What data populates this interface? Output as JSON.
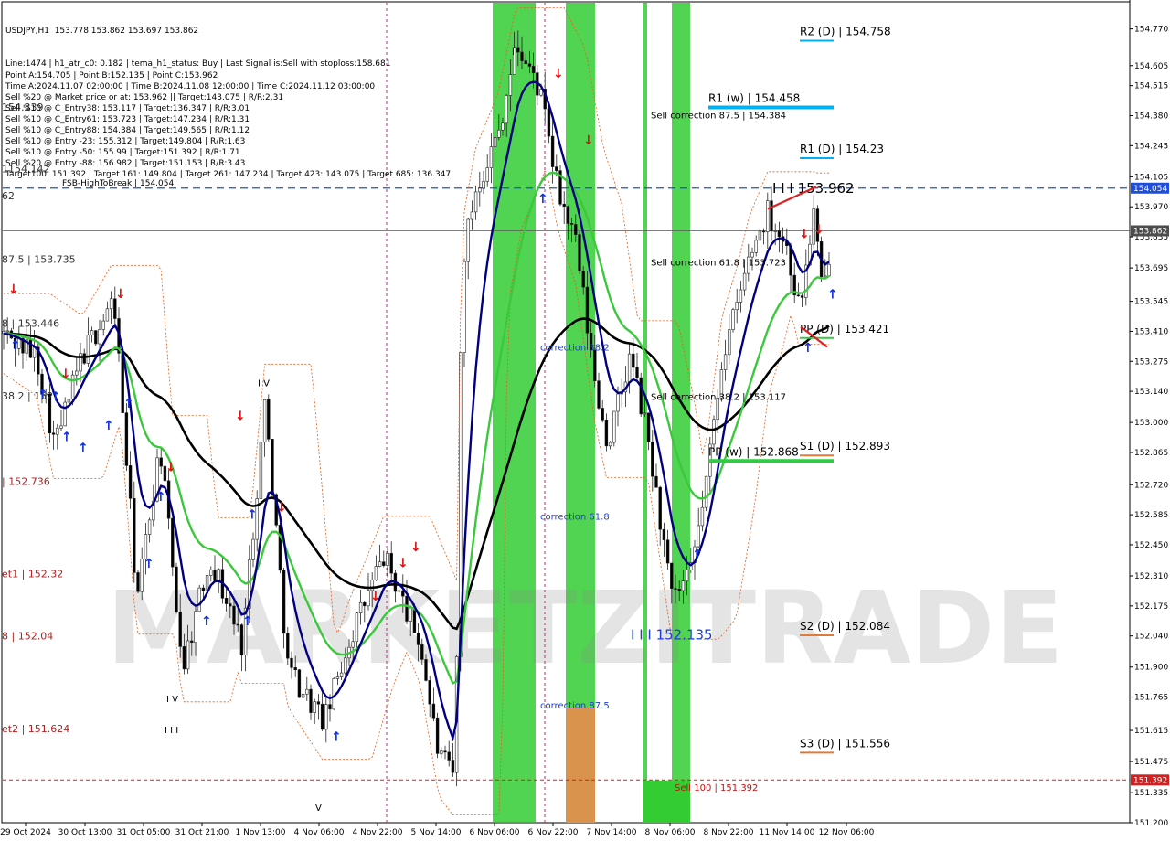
{
  "chart_data": {
    "type": "candlestick",
    "symbol": "USDJPY,H1",
    "ohlc_header": "153.778 153.862 153.697 153.862",
    "info_lines": [
      "Line:1474 | h1_atr_c0: 0.182 | tema_h1_status: Buy | Last Signal is:Sell with stoploss:158.681",
      "Point A:154.705 | Point B:152.135 | Point C:153.962",
      "Time A:2024.11.07 02:00:00 | Time B:2024.11.08 12:00:00 | Time C:2024.11.12 03:00:00",
      "Sell %20 @ Market price or at: 153.962 || Target:143.075 | R/R:2.31",
      "Sell %10 @ C_Entry38: 153.117 | Target:136.347 | R/R:3.01",
      "Sell %10 @ C_Entry61: 153.723 | Target:147.234 | R/R:1.31",
      "Sell %10 @ C_Entry88: 154.384 | Target:149.565 | R/R:1.12",
      "Sell %10 @ Entry -23: 155.312 | Target:149.804 | R/R:1.63",
      "Sell %10 @ Entry -50: 155.99 | Target:151.392 | R/R:1.71",
      "Sell %20 @ Entry -88: 156.982 | Target:151.153 | R/R:3.43",
      "Target100: 151.392 | Target 161: 149.804 | Target 261: 147.234 | Target 423: 143.075 | Target 685: 136.347"
    ],
    "y_range": [
      151.2,
      154.9
    ],
    "y_ticks": [
      "154.770",
      "154.605",
      "154.515",
      "154.380",
      "154.245",
      "154.105",
      "153.970",
      "153.835",
      "153.695",
      "153.545",
      "153.410",
      "153.275",
      "153.140",
      "153.000",
      "152.865",
      "152.720",
      "152.585",
      "152.450",
      "152.310",
      "152.175",
      "152.040",
      "151.900",
      "151.765",
      "151.615",
      "151.475",
      "151.335",
      "151.200"
    ],
    "x_labels": [
      "29 Oct 2024",
      "30 Oct 13:00",
      "31 Oct 05:00",
      "31 Oct 21:00",
      "1 Nov 13:00",
      "4 Nov 06:00",
      "4 Nov 22:00",
      "5 Nov 14:00",
      "6 Nov 06:00",
      "6 Nov 22:00",
      "7 Nov 14:00",
      "8 Nov 06:00",
      "8 Nov 22:00",
      "11 Nov 14:00",
      "12 Nov 06:00"
    ],
    "price_tags": [
      {
        "label": "154.054",
        "value": 154.054,
        "color": "#1f4fd8"
      },
      {
        "label": "153.862",
        "value": 153.862,
        "color": "#4d4d4d"
      },
      {
        "label": "151.392",
        "value": 151.392,
        "color": "#d42020"
      }
    ],
    "levels": [
      {
        "label": "R2 (D) | 154.758",
        "value": 154.758,
        "color": "#00b0f0"
      },
      {
        "label": "R1 (w) | 154.458",
        "value": 154.458,
        "color": "#00b0f0"
      },
      {
        "label": "R1 (D) | 154.23",
        "value": 154.23,
        "color": "#00b0f0"
      },
      {
        "label": "PP (D) | 153.421",
        "value": 153.421,
        "color": "#2ecc40"
      },
      {
        "label": "S1 (D) | 152.893",
        "value": 152.893,
        "color": "#e07a3a"
      },
      {
        "label": "PP (w) | 152.868",
        "value": 152.868,
        "color": "#2ecc40"
      },
      {
        "label": "S2 (D) | 152.084",
        "value": 152.084,
        "color": "#e07a3a"
      },
      {
        "label": "S3 (D) | 151.556",
        "value": 151.556,
        "color": "#e07a3a"
      }
    ],
    "fsb_label": "FSB-HighToBreak | 154.054",
    "annotations": [
      {
        "text": "Sell correction 87.5 | 154.384",
        "value": 154.384
      },
      {
        "text": "Sell correction 61.8 | 153.723",
        "value": 153.723
      },
      {
        "text": "Sell correction 38.2 | 153.117",
        "value": 153.117
      },
      {
        "text": "correction 38.2",
        "value": 153.34
      },
      {
        "text": "correction 61.8",
        "value": 152.58
      },
      {
        "text": "correction 87.5",
        "value": 151.73
      },
      {
        "text": "Sell 100 | 151.392",
        "value": 151.36
      },
      {
        "text": "I I I 153.962",
        "value": 154.05
      },
      {
        "text": "I I I 152.135",
        "value": 152.04
      },
      {
        "text": "I V",
        "value": 153.18
      },
      {
        "text": "I V",
        "value": 151.76
      },
      {
        "text": "I I I",
        "value": 151.62
      },
      {
        "text": "V",
        "value": 151.27
      },
      {
        "text": "I",
        "value": 154.67
      }
    ],
    "left_labels": [
      {
        "text": "1154.142",
        "value": 154.142
      },
      {
        "text": "62",
        "value": 154.02
      },
      {
        "text": "87.5 | 153.735",
        "value": 153.735
      },
      {
        "text": "8 | 153.446",
        "value": 153.446
      },
      {
        "text": "38.2 | 152",
        "value": 153.12
      },
      {
        "text": "| 152.736",
        "value": 152.736
      },
      {
        "text": "et1 | 152.32",
        "value": 152.32
      },
      {
        "text": "8 | 152.04",
        "value": 152.04
      },
      {
        "text": "et2 | 151.624",
        "value": 151.624
      },
      {
        "text": "154.339",
        "value": 154.42
      }
    ],
    "watermark": "MARKETZITRADE",
    "colors": {
      "bull": "#1e9e3a",
      "bear": "#b01818",
      "fsb": "#1f4fd8",
      "band_green": "#33cc33",
      "band_orange": "#d9934d",
      "ema_fast": "#000080",
      "ema_mid": "#3cc83c",
      "ema_slow": "#000000",
      "envelope": "#e85c1a"
    }
  }
}
